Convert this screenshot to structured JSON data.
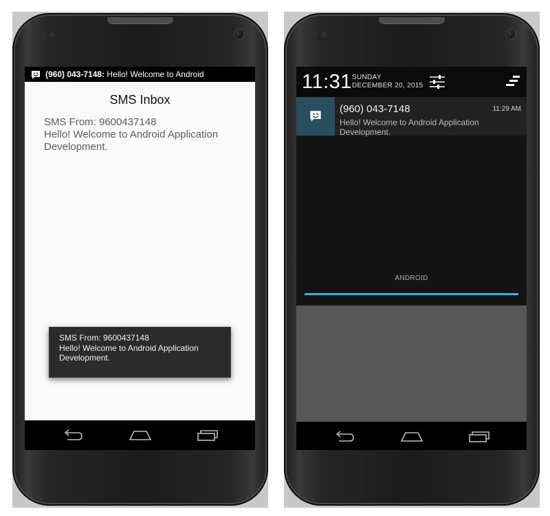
{
  "left": {
    "status_bar": {
      "icon": "sms-icon",
      "ticker_sender": "(960) 043-7148:",
      "ticker_message": "Hello! Welcome to Android"
    },
    "app": {
      "title": "SMS Inbox",
      "sms_from_label": "SMS From: 9600437148",
      "message": "Hello! Welcome to Android Application Development."
    },
    "toast": {
      "line1": "SMS From: 9600437148",
      "line2": "Hello! Welcome to Android Application Development."
    },
    "nav": {
      "back": "back-icon",
      "home": "home-icon",
      "recents": "recents-icon"
    }
  },
  "right": {
    "header": {
      "time": "11:31",
      "day": "SUNDAY",
      "date": "DECEMBER 20, 2015",
      "settings_icon": "quick-settings-icon",
      "clear_icon": "clear-all-icon"
    },
    "notification": {
      "icon": "sms-icon",
      "title": "(960) 043-7148",
      "time": "11:29 AM",
      "text": "Hello! Welcome to Android Application Development."
    },
    "carrier": "ANDROID",
    "nav": {
      "back": "back-icon",
      "home": "home-icon",
      "recents": "recents-icon"
    }
  },
  "colors": {
    "accent": "#33b5e5",
    "notification_icon_bg": "#284e60",
    "app_background": "#fafafa",
    "shade_background": "#141414"
  }
}
